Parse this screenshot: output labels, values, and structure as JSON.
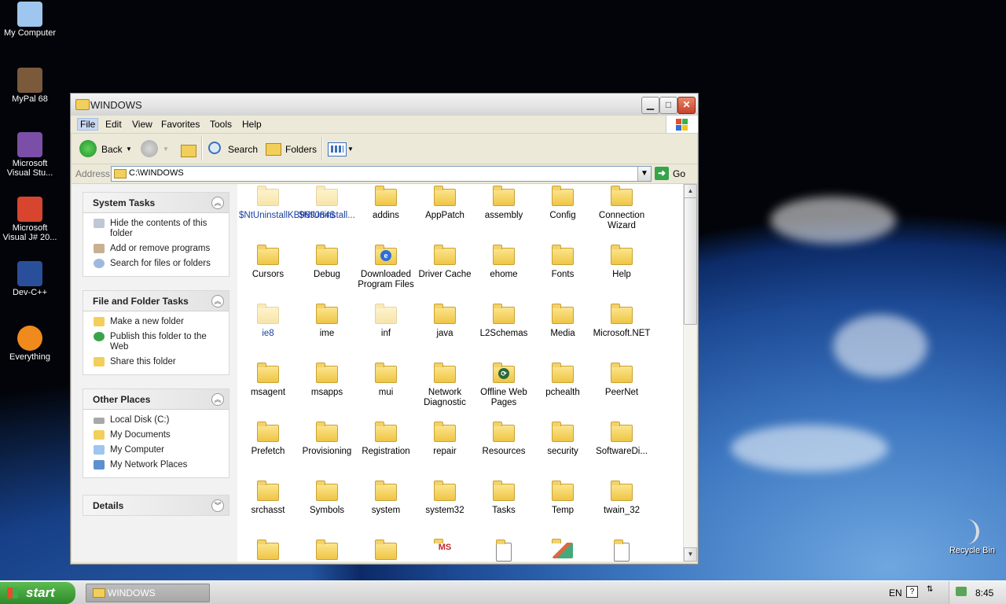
{
  "desktop": {
    "icons": [
      {
        "label": "My Computer",
        "color": "#9ec6ee"
      },
      {
        "label": "MyPal 68",
        "color": "#7a5a3a"
      },
      {
        "label": "Microsoft Visual Stu...",
        "color": "#7b4fa8"
      },
      {
        "label": "Microsoft Visual J# 20...",
        "color": "#d8452e"
      },
      {
        "label": "Dev-C++",
        "color": "#2a4f9a"
      },
      {
        "label": "Everything",
        "color": "#f08a1c"
      }
    ],
    "recycle_bin": "Recycle Bin"
  },
  "window": {
    "title": "WINDOWS",
    "menu": [
      "File",
      "Edit",
      "View",
      "Favorites",
      "Tools",
      "Help"
    ],
    "toolbar": {
      "back": "Back",
      "search": "Search",
      "folders": "Folders"
    },
    "address": {
      "label": "Address",
      "value": "C:\\WINDOWS",
      "go": "Go"
    }
  },
  "taskpane": {
    "system_tasks": {
      "title": "System Tasks",
      "items": [
        "Hide the contents of this folder",
        "Add or remove programs",
        "Search for files or folders"
      ]
    },
    "file_folder_tasks": {
      "title": "File and Folder Tasks",
      "items": [
        "Make a new folder",
        "Publish this folder to the Web",
        "Share this folder"
      ]
    },
    "other_places": {
      "title": "Other Places",
      "items": [
        "Local Disk (C:)",
        "My Documents",
        "My Computer",
        "My Network Places"
      ]
    },
    "details": {
      "title": "Details"
    }
  },
  "files": [
    {
      "name": "$NtUninstallKB969084$",
      "style": "hidden"
    },
    {
      "name": "$NtUninstall...",
      "style": "hidden"
    },
    {
      "name": "addins"
    },
    {
      "name": "AppPatch"
    },
    {
      "name": "assembly"
    },
    {
      "name": "Config"
    },
    {
      "name": "Connection Wizard"
    },
    {
      "name": "Cursors"
    },
    {
      "name": "Debug"
    },
    {
      "name": "Downloaded Program Files",
      "style": "ie"
    },
    {
      "name": "Driver Cache"
    },
    {
      "name": "ehome"
    },
    {
      "name": "Fonts"
    },
    {
      "name": "Help"
    },
    {
      "name": "ie8",
      "style": "hidden"
    },
    {
      "name": "ime"
    },
    {
      "name": "inf",
      "style": "faded"
    },
    {
      "name": "java"
    },
    {
      "name": "L2Schemas"
    },
    {
      "name": "Media"
    },
    {
      "name": "Microsoft.NET"
    },
    {
      "name": "msagent"
    },
    {
      "name": "msapps"
    },
    {
      "name": "mui"
    },
    {
      "name": "Network Diagnostic"
    },
    {
      "name": "Offline Web Pages",
      "style": "sync"
    },
    {
      "name": "pchealth"
    },
    {
      "name": "PeerNet"
    },
    {
      "name": "Prefetch"
    },
    {
      "name": "Provisioning"
    },
    {
      "name": "Registration"
    },
    {
      "name": "repair"
    },
    {
      "name": "Resources"
    },
    {
      "name": "security"
    },
    {
      "name": "SoftwareDi..."
    },
    {
      "name": "srchasst"
    },
    {
      "name": "Symbols"
    },
    {
      "name": "system"
    },
    {
      "name": "system32"
    },
    {
      "name": "Tasks",
      "style": "tasks"
    },
    {
      "name": "Temp"
    },
    {
      "name": "twain_32"
    },
    {
      "name": ""
    },
    {
      "name": ""
    },
    {
      "name": ""
    },
    {
      "name": "",
      "style": "ms"
    },
    {
      "name": "",
      "style": "doc"
    },
    {
      "name": "",
      "style": "paint"
    },
    {
      "name": "",
      "style": "app"
    }
  ],
  "taskbar": {
    "start": "start",
    "window_button": "WINDOWS",
    "language": "EN",
    "time": "8:45"
  }
}
